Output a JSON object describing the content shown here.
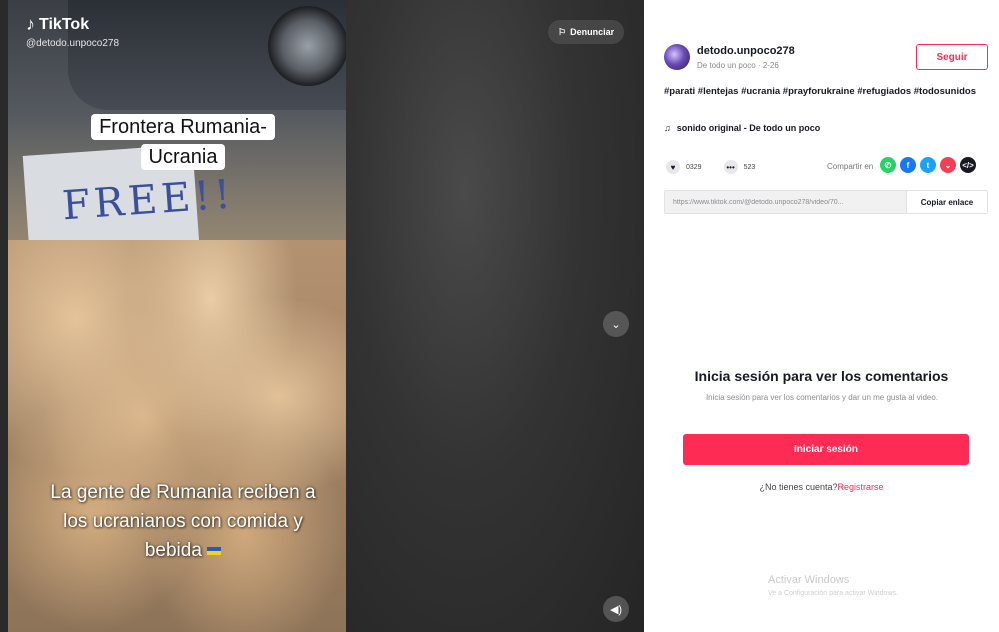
{
  "video": {
    "brand": "TikTok",
    "handle": "@detodo.unpoco278",
    "overlay_title": "Frontera Rumania-Ucrania",
    "sign_text": "FREE!!",
    "caption": "La gente de Rumania reciben a los ucranianos con comida y bebida",
    "report_label": "Denunciar",
    "next_icon": "chevron-down-icon",
    "sound_icon": "volume-icon"
  },
  "panel": {
    "username": "detodo.unpoco278",
    "subname": "De todo un poco · 2-26",
    "follow_label": "Seguir",
    "hashtags": "#parati #lentejas #ucrania #prayforukraine #refugiados #todosunidos",
    "sound": "sonido original - De todo un poco",
    "likes": "0329",
    "comments": "523",
    "share_label": "Compartir en",
    "share_targets": [
      "whatsapp",
      "facebook",
      "twitter",
      "pocket",
      "embed"
    ],
    "link": "https://www.tiktok.com/@detodo.unpoco278/video/70...",
    "copy_label": "Copiar enlace",
    "login_title": "Inicia sesión para ver los comentarios",
    "login_sub": "Inicia sesión para ver los comentarios y dar un me gusta al video.",
    "login_button": "Iniciar sesión",
    "no_account": "¿No tienes cuenta?",
    "register": "Registrarse"
  },
  "windows": {
    "title": "Activar Windows",
    "sub": "Ve a Configuración para activar Windows."
  },
  "colors": {
    "accent": "#fe2c55",
    "text": "#161823",
    "muted": "#8a8b91"
  }
}
